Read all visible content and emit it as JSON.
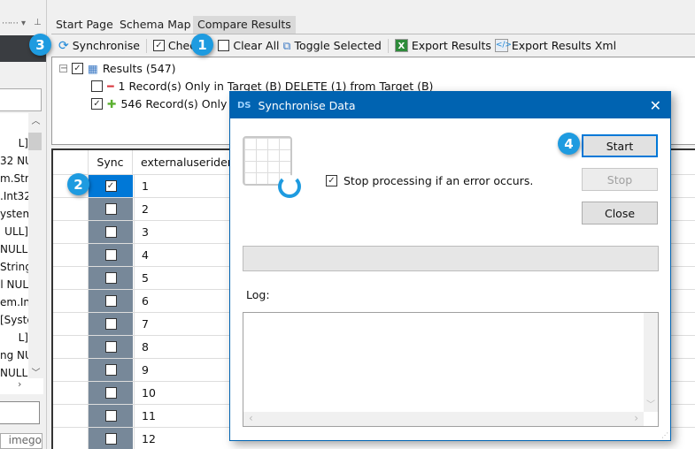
{
  "left_panel": {
    "lines": [
      "L]",
      "32 NU",
      "m.Str",
      ".Int32",
      "ystem",
      "ULL]",
      "NULL]",
      "String",
      "l NUL",
      "em.Int",
      "[Syste",
      "L]",
      "ng NU",
      "NULL]"
    ],
    "bottom_text": "imego"
  },
  "tabs": [
    {
      "label": "Start Page"
    },
    {
      "label": "Schema Map"
    },
    {
      "label": "Compare Results",
      "selected": true
    }
  ],
  "toolbar": {
    "synchronise": "Synchronise",
    "check_all": "Check",
    "clear_all": "Clear All",
    "toggle_selected": "Toggle Selected",
    "export_results": "Export Results",
    "export_results_xml": "Export Results Xml"
  },
  "tree": {
    "root": "Results (547)",
    "root_checked": true,
    "children": [
      {
        "label": "1 Record(s) Only in Target (B) DELETE (1) from Target (B)",
        "checked": false,
        "icon": "minus-icon"
      },
      {
        "label": "546 Record(s) Only in",
        "checked": true,
        "icon": "plus-icon"
      }
    ]
  },
  "grid": {
    "columns": [
      "Sync",
      "externaluseriden"
    ],
    "rows": [
      {
        "sync": true,
        "id": "1"
      },
      {
        "sync": false,
        "id": "2"
      },
      {
        "sync": false,
        "id": "3"
      },
      {
        "sync": false,
        "id": "4"
      },
      {
        "sync": false,
        "id": "5"
      },
      {
        "sync": false,
        "id": "6"
      },
      {
        "sync": false,
        "id": "7"
      },
      {
        "sync": false,
        "id": "8"
      },
      {
        "sync": false,
        "id": "9"
      },
      {
        "sync": false,
        "id": "10"
      },
      {
        "sync": false,
        "id": "11"
      },
      {
        "sync": false,
        "id": "12"
      }
    ]
  },
  "dialog": {
    "title": "Synchronise Data",
    "stop_on_error_label": "Stop processing if an error occurs.",
    "stop_on_error": true,
    "start": "Start",
    "stop": "Stop",
    "close": "Close",
    "log_label": "Log:",
    "progress": 0
  },
  "badges": [
    "1",
    "2",
    "3",
    "4"
  ],
  "colors": {
    "accent": "#0063b1",
    "badge": "#1e9be0",
    "sync_column": "#778899"
  }
}
